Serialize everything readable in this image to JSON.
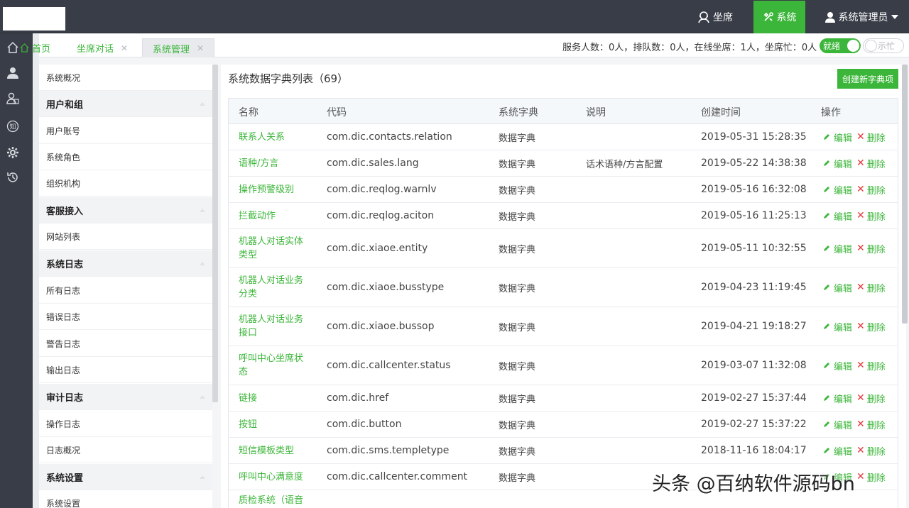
{
  "topbar": {
    "agent_label": "坐席",
    "system_label": "系统",
    "user_label": "系统管理员"
  },
  "rail": {
    "icons": [
      "home-icon",
      "user-icon",
      "contacts-icon",
      "knowledge-icon",
      "settings-icon",
      "history-icon"
    ],
    "knowledge_glyph": "知"
  },
  "tabs": [
    {
      "label": "首页"
    },
    {
      "label": "坐席对话"
    },
    {
      "label": "系统管理"
    }
  ],
  "status": {
    "text": "服务人数：0人，排队数：0人，在线坐席：1人，坐席忙：0人",
    "ready_label": "就绪",
    "busy_label": "示忙"
  },
  "sidemenu": [
    {
      "label": "系统概况",
      "group": false
    },
    {
      "label": "用户和组",
      "group": true
    },
    {
      "label": "用户账号",
      "group": false
    },
    {
      "label": "系统角色",
      "group": false
    },
    {
      "label": "组织机构",
      "group": false
    },
    {
      "label": "客服接入",
      "group": true
    },
    {
      "label": "网站列表",
      "group": false
    },
    {
      "label": "系统日志",
      "group": true
    },
    {
      "label": "所有日志",
      "group": false
    },
    {
      "label": "错误日志",
      "group": false
    },
    {
      "label": "警告日志",
      "group": false
    },
    {
      "label": "输出日志",
      "group": false
    },
    {
      "label": "审计日志",
      "group": true
    },
    {
      "label": "操作日志",
      "group": false
    },
    {
      "label": "日志概况",
      "group": false
    },
    {
      "label": "系统设置",
      "group": true
    },
    {
      "label": "系统设置",
      "group": false
    }
  ],
  "main": {
    "title": "系统数据字典列表（69）",
    "create_label": "创建新字典项",
    "columns": [
      "名称",
      "代码",
      "系统字典",
      "说明",
      "创建时间",
      "操作"
    ],
    "edit_label": "编辑",
    "delete_label": "删除",
    "rows": [
      {
        "name": "联系人关系",
        "code": "com.dic.contacts.relation",
        "sys": "数据字典",
        "desc": "",
        "time": "2019-05-31 15:28:35"
      },
      {
        "name": "语种/方言",
        "code": "com.dic.sales.lang",
        "sys": "数据字典",
        "desc": "话术语种/方言配置",
        "time": "2019-05-22 14:38:38"
      },
      {
        "name": "操作预警级别",
        "code": "com.dic.reqlog.warnlv",
        "sys": "数据字典",
        "desc": "",
        "time": "2019-05-16 16:32:08"
      },
      {
        "name": "拦截动作",
        "code": "com.dic.reqlog.aciton",
        "sys": "数据字典",
        "desc": "",
        "time": "2019-05-16 11:25:13"
      },
      {
        "name": "机器人对话实体类型",
        "code": "com.dic.xiaoe.entity",
        "sys": "数据字典",
        "desc": "",
        "time": "2019-05-11 10:32:55"
      },
      {
        "name": "机器人对话业务分类",
        "code": "com.dic.xiaoe.busstype",
        "sys": "数据字典",
        "desc": "",
        "time": "2019-04-23 11:19:45"
      },
      {
        "name": "机器人对话业务接口",
        "code": "com.dic.xiaoe.bussop",
        "sys": "数据字典",
        "desc": "",
        "time": "2019-04-21 19:18:27"
      },
      {
        "name": "呼叫中心坐席状态",
        "code": "com.dic.callcenter.status",
        "sys": "数据字典",
        "desc": "",
        "time": "2019-03-07 11:32:08"
      },
      {
        "name": "链接",
        "code": "com.dic.href",
        "sys": "数据字典",
        "desc": "",
        "time": "2019-02-27 15:37:44"
      },
      {
        "name": "按钮",
        "code": "com.dic.button",
        "sys": "数据字典",
        "desc": "",
        "time": "2019-02-27 15:37:22"
      },
      {
        "name": "短信模板类型",
        "code": "com.dic.sms.templetype",
        "sys": "数据字典",
        "desc": "",
        "time": "2018-11-16 18:04:17"
      },
      {
        "name": "呼叫中心满意度",
        "code": "com.dic.callcenter.comment",
        "sys": "数据字典",
        "desc": "",
        "time": ""
      },
      {
        "name": "质检系统（语音",
        "code": "",
        "sys": "",
        "desc": "",
        "time": ""
      }
    ]
  },
  "watermark": "头条 @百纳软件源码bn",
  "colors": {
    "accent": "#3cb63a",
    "topbar": "#393d47",
    "danger": "#e4393c"
  }
}
